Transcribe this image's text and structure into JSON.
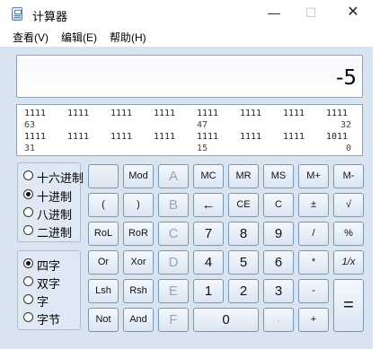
{
  "window": {
    "title": "计算器"
  },
  "controls": {
    "minimize": "—",
    "maximize": "☐",
    "close": "✕"
  },
  "menu": [
    "查看(V)",
    "编辑(E)",
    "帮助(H)"
  ],
  "display": {
    "value": "-5"
  },
  "bits": {
    "row1": [
      "1111",
      "1111",
      "1111",
      "1111",
      "1111",
      "1111",
      "1111",
      "1111"
    ],
    "row1_positions": [
      "63",
      "47",
      "32"
    ],
    "row2": [
      "1111",
      "1111",
      "1111",
      "1111",
      "1111",
      "1111",
      "1111",
      "1011"
    ],
    "row2_positions": [
      "31",
      "15",
      "0"
    ]
  },
  "base_options": [
    {
      "label": "十六进制",
      "selected": false
    },
    {
      "label": "十进制",
      "selected": true
    },
    {
      "label": "八进制",
      "selected": false
    },
    {
      "label": "二进制",
      "selected": false
    }
  ],
  "word_options": [
    {
      "label": "四字",
      "selected": true
    },
    {
      "label": "双字",
      "selected": false
    },
    {
      "label": "字",
      "selected": false
    },
    {
      "label": "字节",
      "selected": false
    }
  ],
  "buttons": {
    "r1": [
      "",
      "Mod",
      "A",
      "MC",
      "MR",
      "MS",
      "M+",
      "M-"
    ],
    "r2": [
      "(",
      ")",
      "B",
      "←",
      "CE",
      "C",
      "±",
      "√"
    ],
    "r3": [
      "RoL",
      "RoR",
      "C",
      "7",
      "8",
      "9",
      "/",
      "%"
    ],
    "r4": [
      "Or",
      "Xor",
      "D",
      "4",
      "5",
      "6",
      "*",
      "1/x"
    ],
    "r5": [
      "Lsh",
      "Rsh",
      "E",
      "1",
      "2",
      "3",
      "-",
      "="
    ],
    "r6": [
      "Not",
      "And",
      "F",
      "0",
      ".",
      "+"
    ]
  }
}
